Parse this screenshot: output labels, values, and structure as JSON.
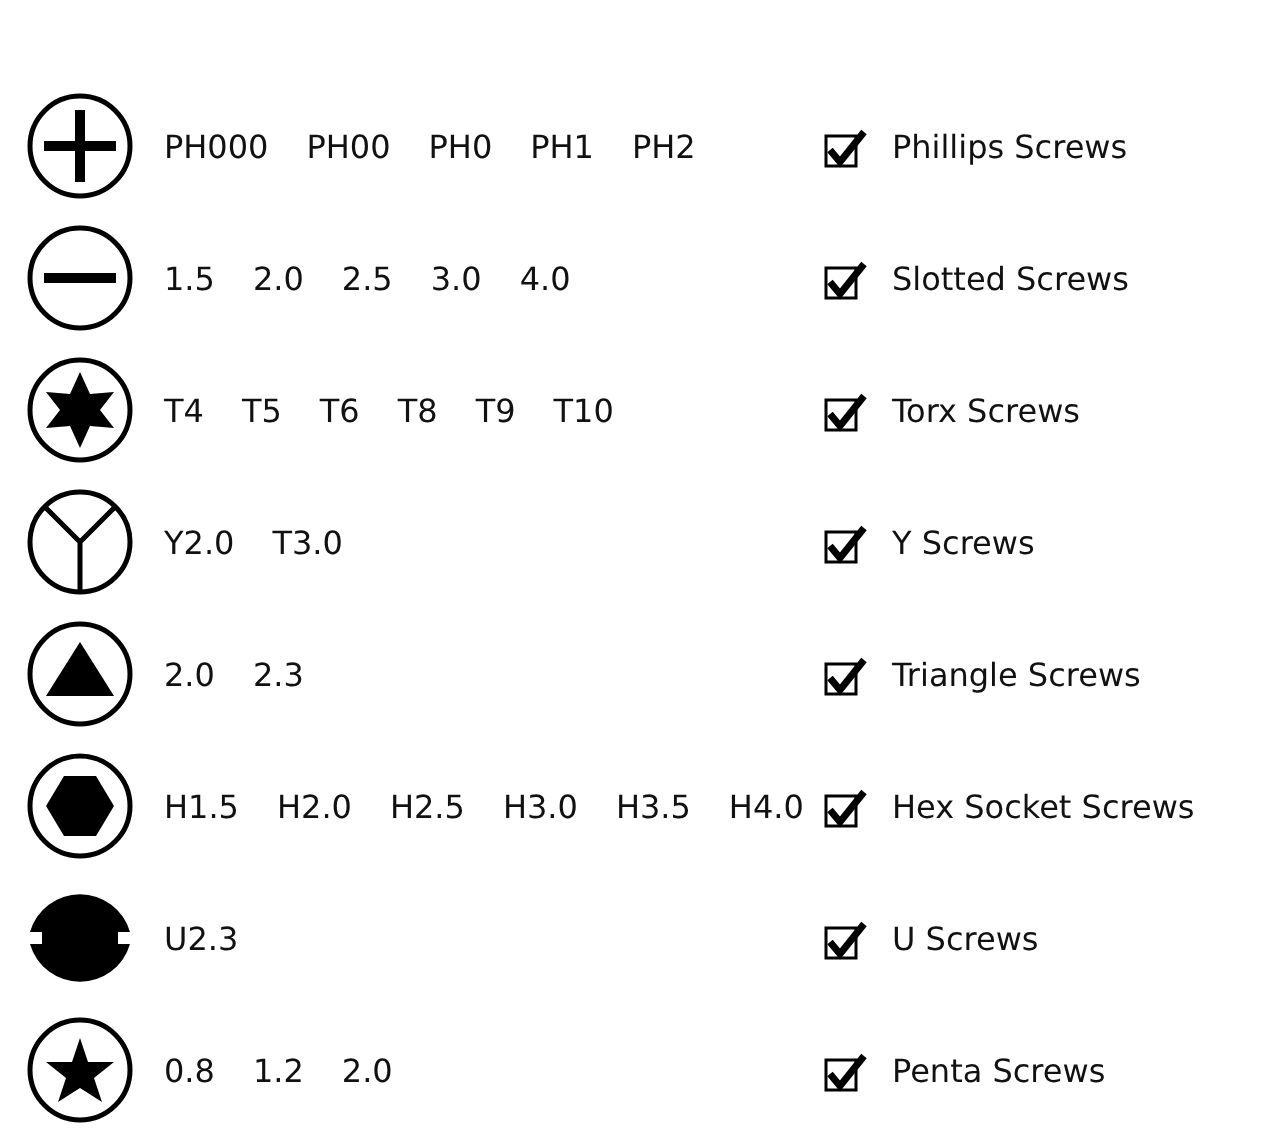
{
  "screw_types": [
    {
      "kind": "phillips",
      "sizes": [
        "PH000",
        "PH00",
        "PH0",
        "PH1",
        "PH2"
      ],
      "label": "Phillips Screws",
      "checked": true
    },
    {
      "kind": "slotted",
      "sizes": [
        "1.5",
        "2.0",
        "2.5",
        "3.0",
        "4.0"
      ],
      "label": "Slotted Screws",
      "checked": true
    },
    {
      "kind": "torx",
      "sizes": [
        "T4",
        "T5",
        "T6",
        "T8",
        "T9",
        "T10"
      ],
      "label": "Torx Screws",
      "checked": true
    },
    {
      "kind": "y",
      "sizes": [
        "Y2.0",
        "T3.0"
      ],
      "label": "Y Screws",
      "checked": true
    },
    {
      "kind": "triangle",
      "sizes": [
        "2.0",
        "2.3"
      ],
      "label": "Triangle Screws",
      "checked": true
    },
    {
      "kind": "hex",
      "sizes": [
        "H1.5",
        "H2.0",
        "H2.5",
        "H3.0",
        "H3.5",
        "H4.0"
      ],
      "label": "Hex Socket Screws",
      "checked": true
    },
    {
      "kind": "u",
      "sizes": [
        "U2.3"
      ],
      "label": "U Screws",
      "checked": true
    },
    {
      "kind": "penta",
      "sizes": [
        "0.8",
        "1.2",
        "2.0"
      ],
      "label": "Penta Screws",
      "checked": true
    }
  ]
}
